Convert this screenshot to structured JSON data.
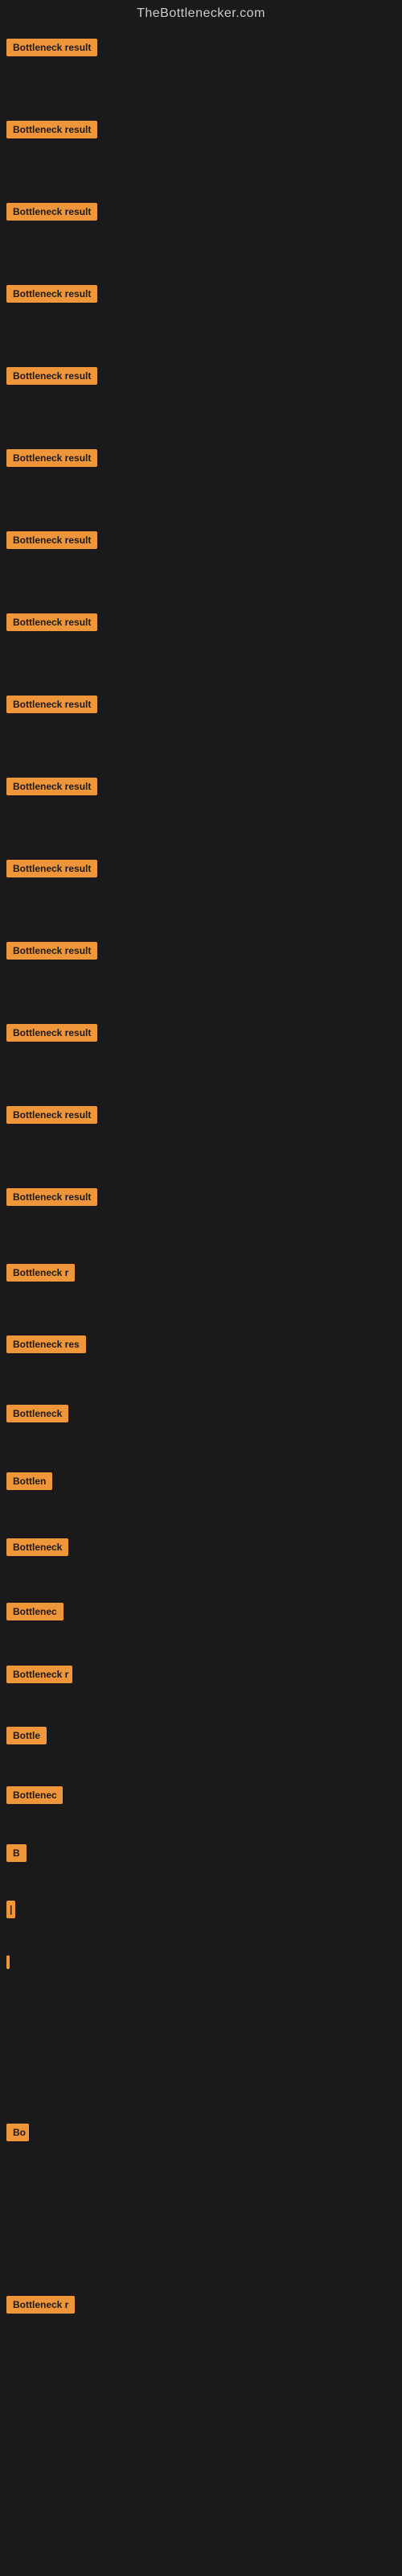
{
  "site": {
    "title": "TheBottlenecker.com"
  },
  "rows": [
    {
      "id": 1,
      "label": "Bottleneck result",
      "visible_text": "Bottleneck result"
    },
    {
      "id": 2,
      "label": "Bottleneck result",
      "visible_text": "Bottleneck result"
    },
    {
      "id": 3,
      "label": "Bottleneck result",
      "visible_text": "Bottleneck result"
    },
    {
      "id": 4,
      "label": "Bottleneck result",
      "visible_text": "Bottleneck result"
    },
    {
      "id": 5,
      "label": "Bottleneck result",
      "visible_text": "Bottleneck result"
    },
    {
      "id": 6,
      "label": "Bottleneck result",
      "visible_text": "Bottleneck result"
    },
    {
      "id": 7,
      "label": "Bottleneck result",
      "visible_text": "Bottleneck result"
    },
    {
      "id": 8,
      "label": "Bottleneck result",
      "visible_text": "Bottleneck result"
    },
    {
      "id": 9,
      "label": "Bottleneck result",
      "visible_text": "Bottleneck result"
    },
    {
      "id": 10,
      "label": "Bottleneck result",
      "visible_text": "Bottleneck result"
    },
    {
      "id": 11,
      "label": "Bottleneck result",
      "visible_text": "Bottleneck result"
    },
    {
      "id": 12,
      "label": "Bottleneck result",
      "visible_text": "Bottleneck result"
    },
    {
      "id": 13,
      "label": "Bottleneck result",
      "visible_text": "Bottleneck result"
    },
    {
      "id": 14,
      "label": "Bottleneck result",
      "visible_text": "Bottleneck result"
    },
    {
      "id": 15,
      "label": "Bottleneck result",
      "visible_text": "Bottleneck result"
    },
    {
      "id": 16,
      "label": "Bottleneck r",
      "visible_text": "Bottleneck r"
    },
    {
      "id": 17,
      "label": "Bottleneck res",
      "visible_text": "Bottleneck res"
    },
    {
      "id": 18,
      "label": "Bottleneck",
      "visible_text": "Bottleneck"
    },
    {
      "id": 19,
      "label": "Bottlen",
      "visible_text": "Bottlen"
    },
    {
      "id": 20,
      "label": "Bottleneck",
      "visible_text": "Bottleneck"
    },
    {
      "id": 21,
      "label": "Bottlenec",
      "visible_text": "Bottlenec"
    },
    {
      "id": 22,
      "label": "Bottleneck r",
      "visible_text": "Bottleneck r"
    },
    {
      "id": 23,
      "label": "Bottle",
      "visible_text": "Bottle"
    },
    {
      "id": 24,
      "label": "Bottlenec",
      "visible_text": "Bottlenec"
    },
    {
      "id": 25,
      "label": "B",
      "visible_text": "B"
    },
    {
      "id": 26,
      "label": "|",
      "visible_text": "|"
    },
    {
      "id": 27,
      "label": "",
      "visible_text": ""
    },
    {
      "id": 28,
      "label": "Bo",
      "visible_text": "Bo"
    },
    {
      "id": 29,
      "label": "Bottleneck r",
      "visible_text": "Bottleneck r"
    }
  ],
  "colors": {
    "background": "#1a1a1a",
    "badge_bg": "#f0963a",
    "badge_text": "#1a1a1a",
    "title_text": "#cccccc"
  }
}
